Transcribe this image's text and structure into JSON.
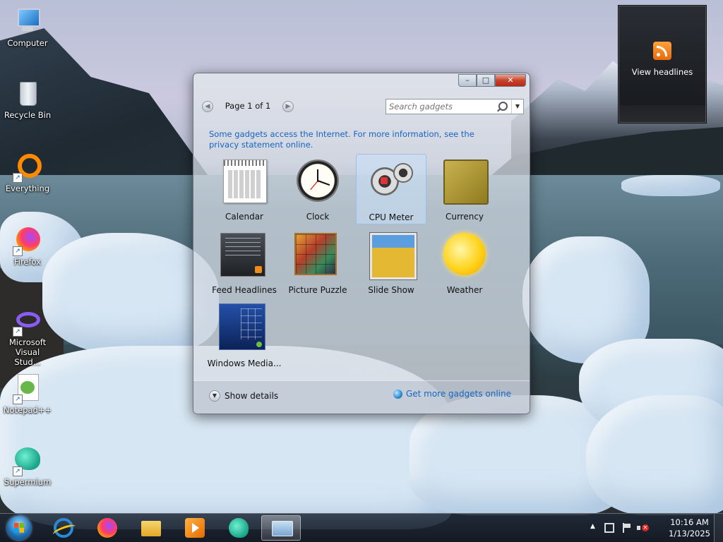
{
  "desktop": {
    "icons": [
      {
        "label": "Computer",
        "icon": "computer-icon",
        "shortcut": false
      },
      {
        "label": "Recycle Bin",
        "icon": "recycle-bin-icon",
        "shortcut": false
      },
      {
        "label": "Everything",
        "icon": "everything-icon",
        "shortcut": true
      },
      {
        "label": "Firefox",
        "icon": "firefox-icon",
        "shortcut": true
      },
      {
        "label": "Microsoft Visual Stud...",
        "icon": "visual-studio-icon",
        "shortcut": true
      },
      {
        "label": "Notepad++",
        "icon": "notepad-plus-plus-icon",
        "shortcut": true
      },
      {
        "label": "Supermium",
        "icon": "supermium-icon",
        "shortcut": true
      }
    ]
  },
  "rss_gadget": {
    "label": "View headlines",
    "icon": "rss-icon"
  },
  "gallery": {
    "controls": {
      "minimize": "–",
      "maximize": "□",
      "close": "✕"
    },
    "pager": {
      "label": "Page 1 of 1",
      "prev": "◀",
      "next": "▶"
    },
    "search": {
      "placeholder": "Search gadgets",
      "dropdown": "▼"
    },
    "notice": "Some gadgets access the Internet.  For more information, see the privacy statement online.",
    "gadgets": [
      {
        "name": "Calendar",
        "icon": "calendar-icon",
        "selected": false
      },
      {
        "name": "Clock",
        "icon": "clock-icon",
        "selected": false
      },
      {
        "name": "CPU Meter",
        "icon": "cpu-meter-icon",
        "selected": true
      },
      {
        "name": "Currency",
        "icon": "currency-icon",
        "selected": false
      },
      {
        "name": "Feed Headlines",
        "icon": "feed-headlines-icon",
        "selected": false
      },
      {
        "name": "Picture Puzzle",
        "icon": "picture-puzzle-icon",
        "selected": false
      },
      {
        "name": "Slide Show",
        "icon": "slide-show-icon",
        "selected": false
      },
      {
        "name": "Weather",
        "icon": "weather-icon",
        "selected": false
      },
      {
        "name": "Windows Media...",
        "icon": "windows-media-center-icon",
        "selected": false
      }
    ],
    "footer": {
      "details_label": "Show details",
      "details_icon": "chevron-down-icon",
      "more_link": "Get more gadgets online",
      "more_icon": "globe-icon"
    }
  },
  "taskbar": {
    "start_icon": "windows-start-orb-icon",
    "apps": [
      {
        "icon": "internet-explorer-icon",
        "active": false
      },
      {
        "icon": "firefox-icon",
        "active": false
      },
      {
        "icon": "file-explorer-icon",
        "active": false
      },
      {
        "icon": "media-player-icon",
        "active": false
      },
      {
        "icon": "supermium-icon",
        "active": false
      },
      {
        "icon": "gadget-gallery-icon",
        "active": true
      }
    ],
    "tray": {
      "overflow": "▲",
      "icons": [
        "network-icon",
        "action-center-flag-icon",
        "volume-muted-icon"
      ],
      "time": "10:16 AM",
      "date": "1/13/2025"
    }
  }
}
